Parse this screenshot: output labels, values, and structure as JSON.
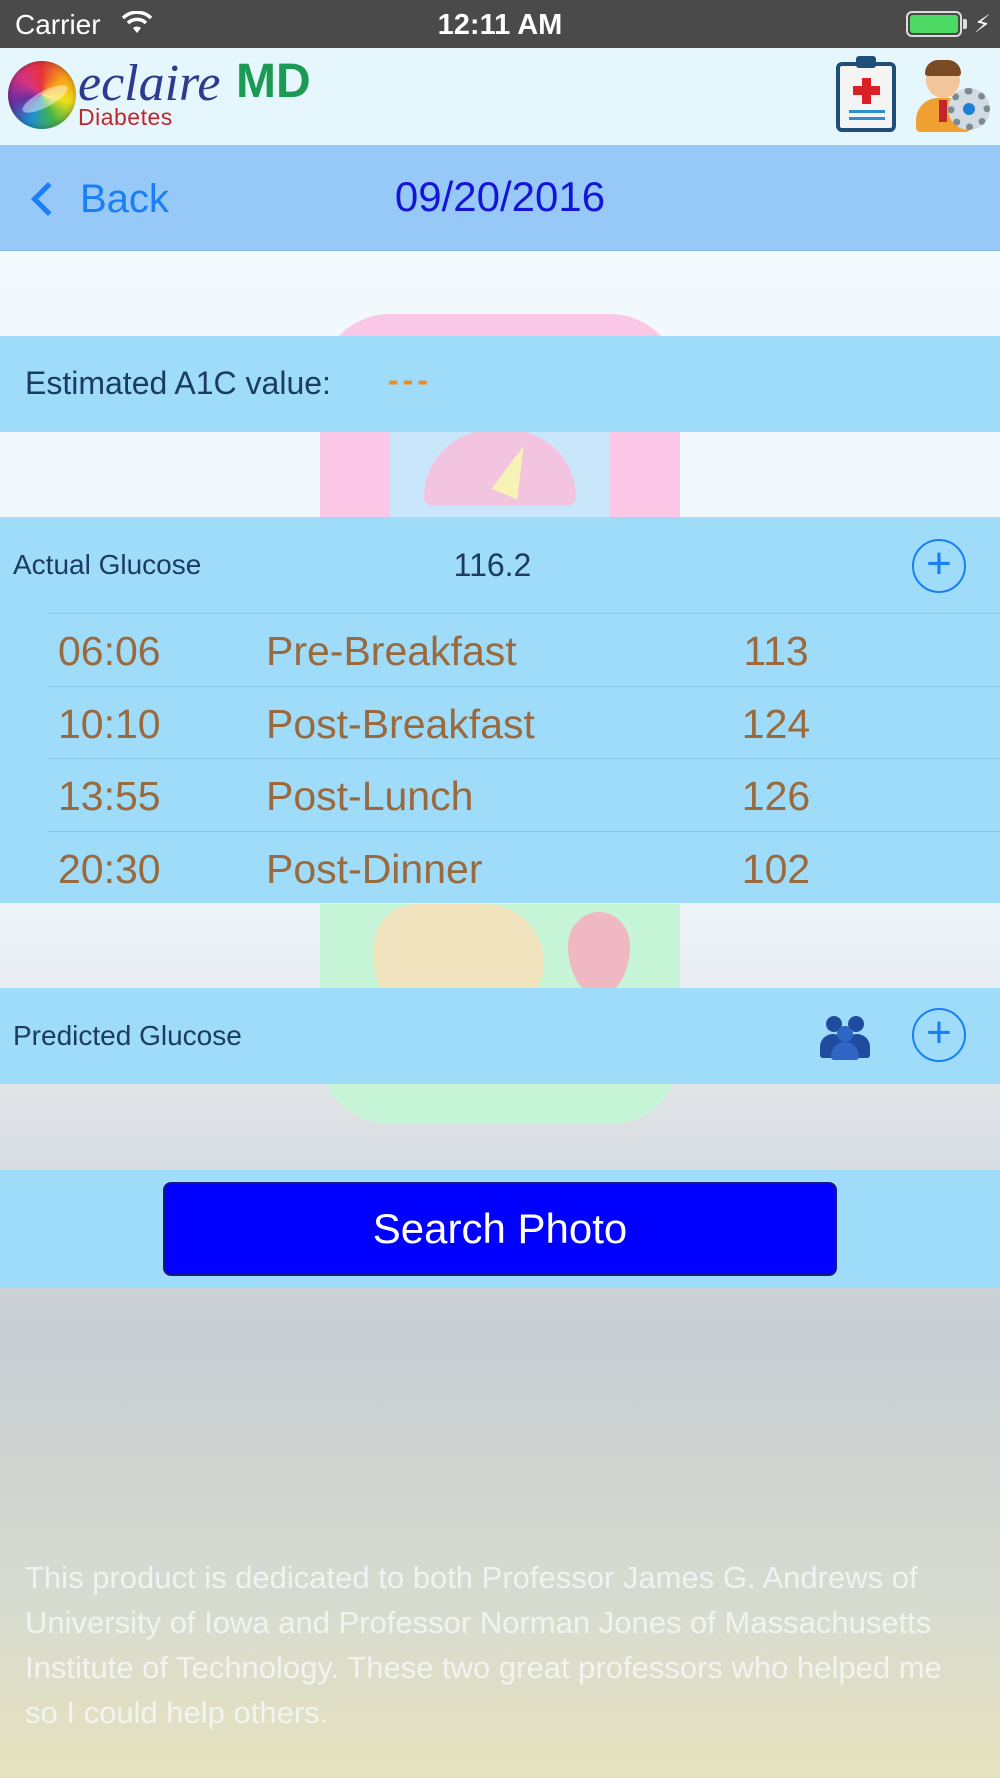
{
  "status_bar": {
    "carrier": "Carrier",
    "time": "12:11 AM",
    "battery_level": 1.0
  },
  "header": {
    "logo_name": "eclaire",
    "logo_md": "MD",
    "logo_sub": "Diabetes",
    "icons": [
      "clipboard-medical-icon",
      "doctor-settings-icon"
    ]
  },
  "nav": {
    "back_label": "Back",
    "title": "09/20/2016"
  },
  "a1c": {
    "label": "Estimated A1C value:",
    "value": "---"
  },
  "actual_glucose": {
    "label": "Actual Glucose",
    "value": "116.2",
    "add_icon": "plus-circle-icon",
    "readings": [
      {
        "time": "06:06",
        "label": "Pre-Breakfast",
        "value": "113"
      },
      {
        "time": "10:10",
        "label": "Post-Breakfast",
        "value": "124"
      },
      {
        "time": "13:55",
        "label": "Post-Lunch",
        "value": "126"
      },
      {
        "time": "20:30",
        "label": "Post-Dinner",
        "value": "102"
      }
    ]
  },
  "predicted_glucose": {
    "label": "Predicted Glucose",
    "group_icon": "users-group-icon",
    "add_icon": "plus-circle-icon"
  },
  "search": {
    "button_label": "Search Photo"
  },
  "dedication": "This product is dedicated to both Professor James G. Andrews of University of Iowa and Professor Norman Jones of Massachusetts Institute of Technology.  These two great professors who helped me so I could help others.",
  "colors": {
    "nav_bar": "#96c8f8",
    "band": "#9edcfa",
    "accent_blue": "#1a7ef5",
    "reading_text": "#9a6a3e",
    "search_button": "#0000ff"
  }
}
